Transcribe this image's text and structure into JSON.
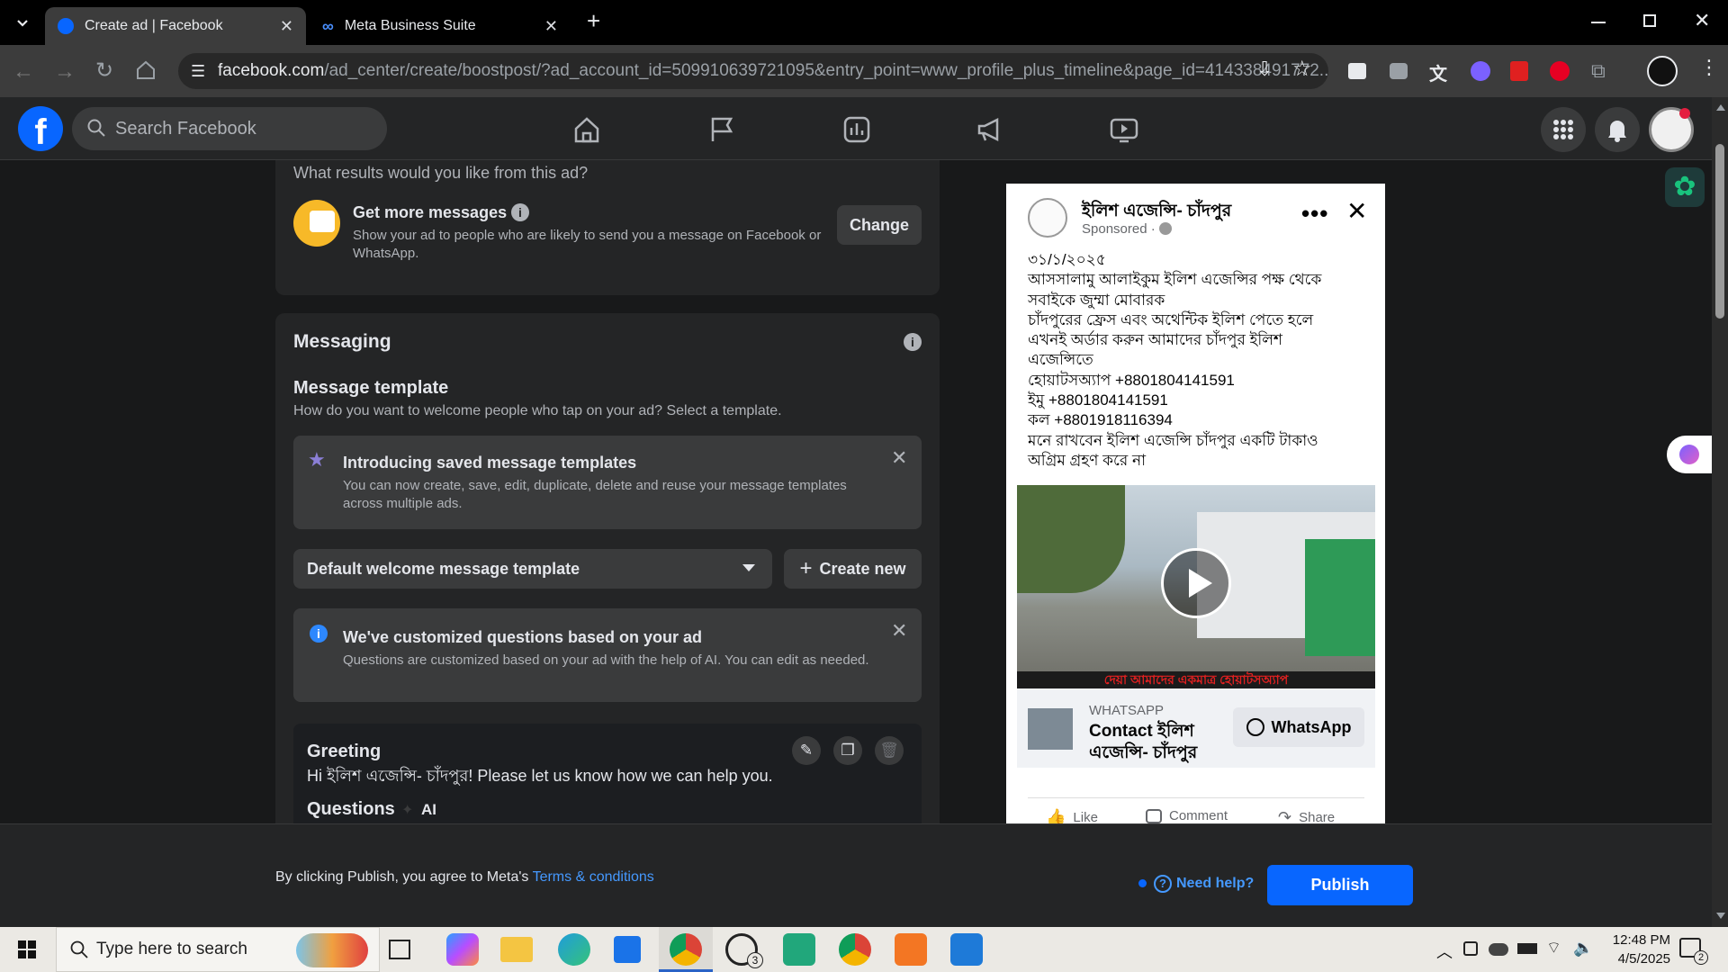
{
  "browser": {
    "tabs": [
      {
        "title": "Create ad | Facebook",
        "active": true
      },
      {
        "title": "Meta Business Suite",
        "active": false
      }
    ],
    "new_tab_label": "+",
    "url_host": "facebook.com",
    "url_path": "/ad_center/create/boostpost/?ad_account_id=509910639721095&entry_point=www_profile_plus_timeline&page_id=414338491772..."
  },
  "fb": {
    "search_placeholder": "Search Facebook",
    "accent": "#0866ff"
  },
  "goal": {
    "question": "What results would you like from this ad?",
    "title": "Get more messages",
    "description": "Show your ad to people who are likely to send you a message on Facebook or WhatsApp.",
    "change_label": "Change"
  },
  "messaging": {
    "heading": "Messaging",
    "template_title": "Message template",
    "template_desc": "How do you want to welcome people who tap on your ad? Select a template.",
    "intro_title": "Introducing saved message templates",
    "intro_desc": "You can now create, save, edit, duplicate, delete and reuse your message templates across multiple ads.",
    "dropdown_value": "Default welcome message template",
    "create_new_label": "Create new",
    "custom_title": "We've customized questions based on your ad",
    "custom_desc": "Questions are customized based on your ad with the help of AI. You can edit as needed.",
    "greeting_title": "Greeting",
    "greeting_text": "Hi ইলিশ এজেন্সি- চাঁদপুর! Please let us know how we can help you.",
    "questions_title": "Questions",
    "ai_label": "AI"
  },
  "preview": {
    "page_name": "ইলিশ এজেন্সি- চাঁদপুর",
    "sponsored": "Sponsored ·",
    "post_lines": [
      "৩১/১/২০২৫",
      "আসসালামু আলাইকুম ইলিশ এজেন্সির পক্ষ থেকে",
      "সবাইকে জুম্মা মোবারক",
      "চাঁদপুরের ফ্রেস এবং অথেন্টিক ইলিশ পেতে হলে",
      "এখনই অর্ডার করুন আমাদের চাঁদপুর ইলিশ",
      "এজেন্সিতে",
      "হোয়াটসঅ্যাপ +8801804141591",
      "ইমু +8801804141591",
      "কল +8801918116394",
      "মনে রাখবেন ইলিশ এজেন্সি চাঁদপুর একটি টাকাও",
      "অগ্রিম গ্রহণ করে না"
    ],
    "video_caption": "দেয়া আমাদের একমাত্র হোয়াটসঅ্যাপ",
    "cta_source": "WHATSAPP",
    "cta_title": "Contact ইলিশ এজেন্সি- চাঁদপুর",
    "cta_button": "WhatsApp",
    "actions": [
      "Like",
      "Comment",
      "Share"
    ]
  },
  "footer": {
    "agree_text": "By clicking Publish, you agree to Meta's ",
    "terms_link": "Terms & conditions",
    "help_label": "Need help?",
    "publish_label": "Publish"
  },
  "taskbar": {
    "search_placeholder": "Type here to search",
    "time": "12:48 PM",
    "date": "4/5/2025",
    "whatsapp_badge": "3",
    "notification_count": "2"
  }
}
